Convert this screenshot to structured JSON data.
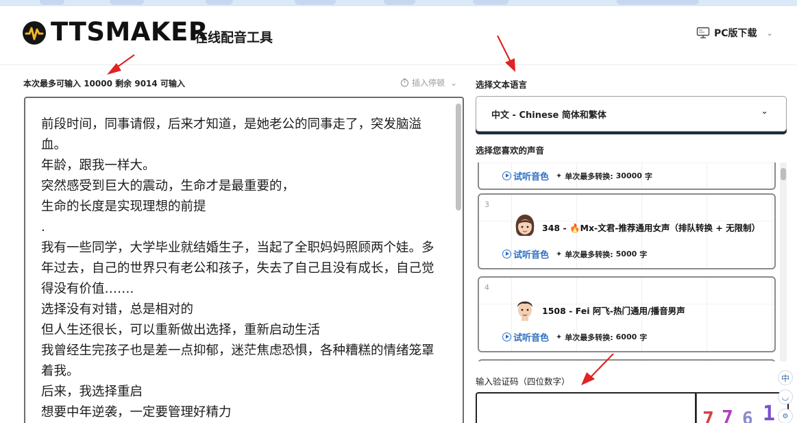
{
  "header": {
    "logo_text": "TTSMAKER",
    "subtitle": "在线配音工具",
    "pc_download": "PC版下载"
  },
  "editor": {
    "limit_prefix": "本次最多可输入",
    "limit_max": "10000",
    "limit_mid": "剩余",
    "limit_remaining": "9014",
    "limit_suffix": "可输入",
    "pause_insert": "插入停顿",
    "text": "前段时间，同事请假，后来才知道，是她老公的同事走了，突发脑溢血。\n年龄，跟我一样大。\n突然感受到巨大的震动，生命才是最重要的，\n生命的长度是实现理想的前提\n.\n我有一些同学，大学毕业就结婚生子，当起了全职妈妈照顾两个娃。多年过去，自己的世界只有老公和孩子，失去了自己且没有成长，自己觉得没有价值…….\n选择没有对错，总是相对的\n但人生还很长，可以重新做出选择，重新启动生活\n我曾经生完孩子也是差一点抑郁，迷茫焦虑恐惧，各种糟糕的情绪笼罩着我。\n后来，我选择重启\n想要中年逆袭，一定要管理好精力"
  },
  "language": {
    "label": "选择文本语言",
    "selected": "中文 - Chinese 简体和繁体"
  },
  "voices": {
    "label": "选择您喜欢的声音",
    "listen_label": "试听音色",
    "max_prefix": "单次最多转换:",
    "unit": "字",
    "items": [
      {
        "index": "",
        "name": "",
        "max": "30000"
      },
      {
        "index": "3",
        "name": "348 - 🔥Mx-文君-推荐通用女声（排队转换 + 无限制）",
        "max": "5000"
      },
      {
        "index": "4",
        "name": "1508 - Fei 阿飞-热门通用/播音男声",
        "max": "6000"
      }
    ]
  },
  "captcha": {
    "label": "输入验证码（四位数字）",
    "chars": [
      "7",
      "7",
      "6",
      "1"
    ]
  },
  "float_buttons": [
    "中",
    "◡"
  ],
  "colors": {
    "accent_blue": "#2b6fc3",
    "annotation_red": "#e02323",
    "dark_border": "#1d2b3d"
  }
}
